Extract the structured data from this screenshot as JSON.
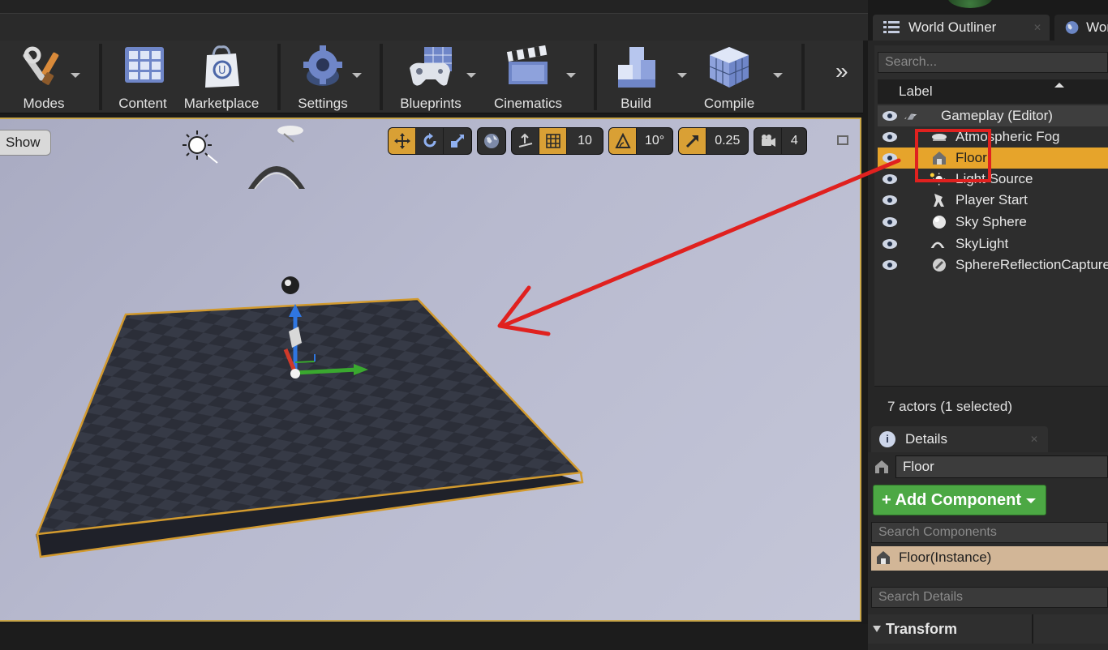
{
  "toolbar": {
    "buttons": [
      {
        "label": "Modes",
        "icon": "wrench-brush-icon"
      },
      {
        "label": "Content",
        "icon": "content-grid-icon"
      },
      {
        "label": "Marketplace",
        "icon": "shopping-bag-icon"
      },
      {
        "label": "Settings",
        "icon": "gear-icon"
      },
      {
        "label": "Blueprints",
        "icon": "gamepad-icon"
      },
      {
        "label": "Cinematics",
        "icon": "clapperboard-icon"
      },
      {
        "label": "Build",
        "icon": "cubes-icon"
      },
      {
        "label": "Compile",
        "icon": "compile-cube-icon"
      }
    ],
    "more": "»"
  },
  "viewport": {
    "show_label": "Show",
    "grid_snap": "10",
    "rotation_snap": "10°",
    "scale_snap": "0.25",
    "camera_speed": "4"
  },
  "outliner": {
    "tab_title": "World Outliner",
    "second_tab_title": "Wor",
    "search_placeholder": "Search...",
    "column_label": "Label",
    "group": "Gameplay (Editor)",
    "items": [
      {
        "label": "Atmospheric Fog",
        "icon": "fog-icon",
        "selected": false
      },
      {
        "label": "Floor",
        "icon": "static-mesh-icon",
        "selected": true
      },
      {
        "label": "Light Source",
        "icon": "directional-light-icon",
        "selected": false
      },
      {
        "label": "Player Start",
        "icon": "player-start-icon",
        "selected": false
      },
      {
        "label": "Sky Sphere",
        "icon": "sphere-icon",
        "selected": false
      },
      {
        "label": "SkyLight",
        "icon": "skylight-icon",
        "selected": false
      },
      {
        "label": "SphereReflectionCapture",
        "icon": "reflection-capture-icon",
        "selected": false
      }
    ],
    "status": "7 actors (1 selected)"
  },
  "details": {
    "tab_title": "Details",
    "actor_name": "Floor",
    "add_component": "+ Add Component",
    "search_components_placeholder": "Search Components",
    "component_instance": "Floor(Instance)",
    "search_details_placeholder": "Search Details",
    "section_transform": "Transform"
  },
  "colors": {
    "selection": "#e6a42b",
    "annotation": "#e0211f",
    "add_component": "#4ca844"
  }
}
